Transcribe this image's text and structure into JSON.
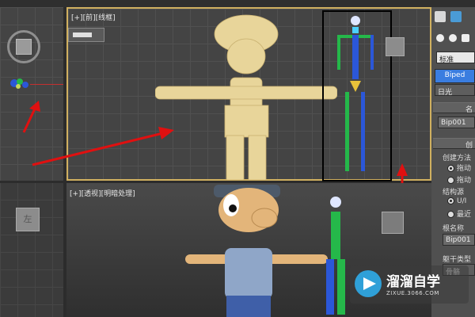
{
  "viewports": {
    "top_right_label": "[+][前][线框]",
    "bottom_right_label": "[+][透视][明暗处理]",
    "top_left_cube": "",
    "bottom_left_cube": "左"
  },
  "command_panel": {
    "dropdown_value": "标准",
    "biped_button": "Biped",
    "sunlight_button": "日光",
    "name_rollout_header": "名",
    "name_field_value": "Bip001",
    "creation_rollout_header": "创",
    "creation_method_label": "创建方法",
    "creation_options": [
      "拖动",
      "拖动"
    ],
    "structure_source_label": "结构源",
    "structure_options": [
      "U/I",
      "最近"
    ],
    "root_name_label": "根名称",
    "root_name_value": "Bip001",
    "trunk_type_label": "躯干类型",
    "trunk_type_value": "骨骼"
  },
  "watermark": {
    "brand": "溜溜自学",
    "url": "ZIXUE.3066.COM"
  },
  "colors": {
    "arrow": "#e01010",
    "mesh": "#e8d59a",
    "biped_blue": "#2b57d8",
    "biped_green": "#25b84a",
    "selection_box": "#000000"
  }
}
